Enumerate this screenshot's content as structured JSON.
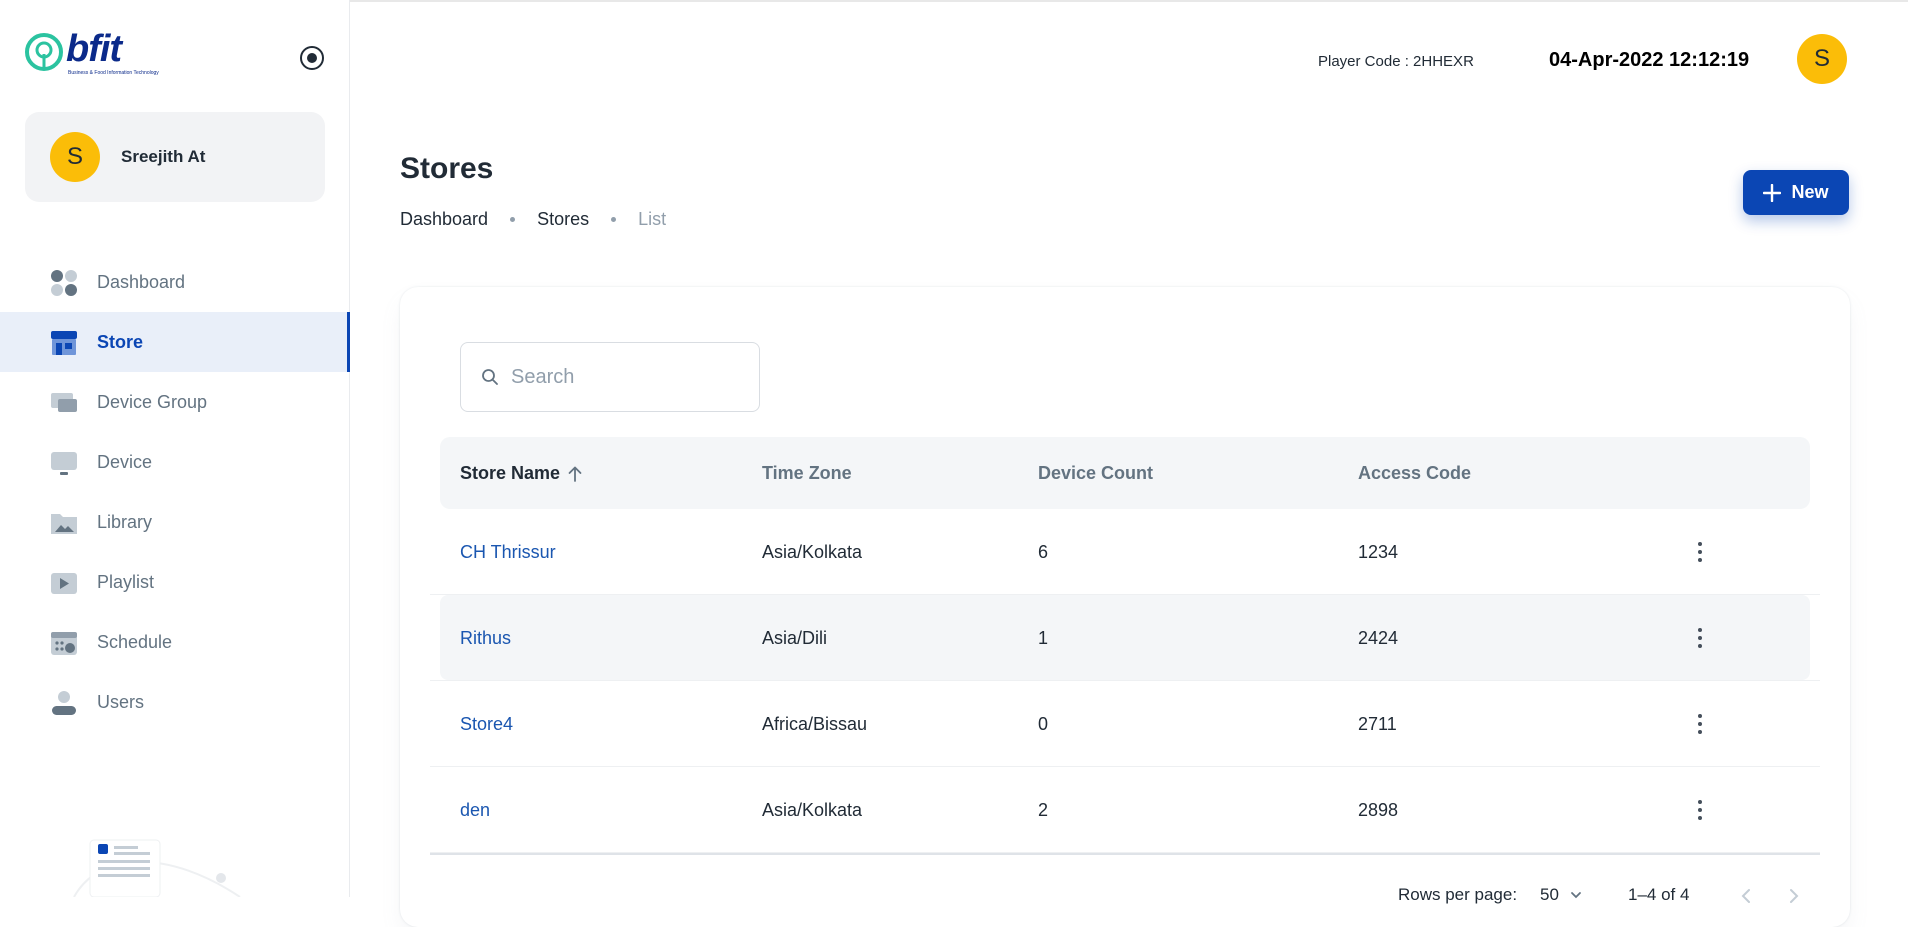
{
  "brand": {
    "logo_text": "bfit",
    "tagline": "Business & Food Information Technology"
  },
  "account": {
    "initial": "S",
    "name": "Sreejith At"
  },
  "nav": {
    "items": [
      {
        "label": "Dashboard",
        "icon": "dashboard-icon"
      },
      {
        "label": "Store",
        "icon": "store-icon",
        "active": true
      },
      {
        "label": "Device Group",
        "icon": "device-group-icon"
      },
      {
        "label": "Device",
        "icon": "device-icon"
      },
      {
        "label": "Library",
        "icon": "library-icon"
      },
      {
        "label": "Playlist",
        "icon": "playlist-icon"
      },
      {
        "label": "Schedule",
        "icon": "schedule-icon"
      },
      {
        "label": "Users",
        "icon": "users-icon"
      }
    ]
  },
  "header": {
    "player_code": "Player Code : 2HHEXR",
    "datetime": "04-Apr-2022 12:12:19",
    "avatar_initial": "S"
  },
  "page": {
    "title": "Stores",
    "breadcrumb": [
      "Dashboard",
      "Stores",
      "List"
    ],
    "new_button": "New"
  },
  "search": {
    "placeholder": "Search",
    "value": ""
  },
  "table": {
    "columns": [
      "Store Name",
      "Time Zone",
      "Device Count",
      "Access Code"
    ],
    "sorted_column": "Store Name",
    "rows": [
      {
        "name": "CH Thrissur",
        "timezone": "Asia/Kolkata",
        "device_count": "6",
        "access_code": "1234"
      },
      {
        "name": "Rithus",
        "timezone": "Asia/Dili",
        "device_count": "1",
        "access_code": "2424"
      },
      {
        "name": "Store4",
        "timezone": "Africa/Bissau",
        "device_count": "0",
        "access_code": "2711"
      },
      {
        "name": "den",
        "timezone": "Asia/Kolkata",
        "device_count": "2",
        "access_code": "2898"
      }
    ]
  },
  "pagination": {
    "rows_per_page_label": "Rows per page:",
    "rows_per_page": "50",
    "range": "1–4 of 4"
  },
  "colors": {
    "primary": "#0b46b4",
    "avatar": "#fbbd08",
    "link": "#1a56b0"
  }
}
